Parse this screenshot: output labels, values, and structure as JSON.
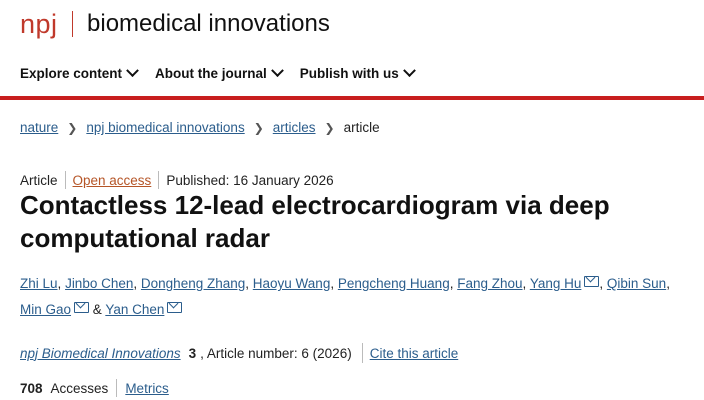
{
  "header": {
    "brand": "npj",
    "journal_title": "biomedical innovations"
  },
  "nav": {
    "items": [
      {
        "label": "Explore content"
      },
      {
        "label": "About the journal"
      },
      {
        "label": "Publish with us"
      }
    ]
  },
  "colors": {
    "accent_red": "#c81e1e",
    "link_blue": "#2b5d8c",
    "open_access_orange": "#b55527"
  },
  "breadcrumb": {
    "items": [
      "nature",
      "npj biomedical innovations",
      "articles"
    ],
    "current": "article"
  },
  "article": {
    "type": "Article",
    "access": "Open access",
    "published": "Published: 16 January 2026",
    "title": "Contactless 12-lead electrocardiogram via deep computational radar",
    "authors": [
      "Zhi Lu",
      "Jinbo Chen",
      "Dongheng Zhang",
      "Haoyu Wang",
      "Pengcheng Huang",
      "Fang Zhou",
      "Yang Hu",
      "Qibin Sun",
      "Min Gao",
      "Yan Chen"
    ],
    "separator_comma": ",",
    "separator_and": "&",
    "citation": {
      "journal": "npj Biomedical Innovations",
      "volume": "3",
      "article_number": ", Article number: 6 (2026)",
      "cite_label": "Cite this article"
    },
    "metrics": {
      "accesses_count": "708",
      "accesses_label": "Accesses",
      "metrics_label": "Metrics"
    }
  }
}
